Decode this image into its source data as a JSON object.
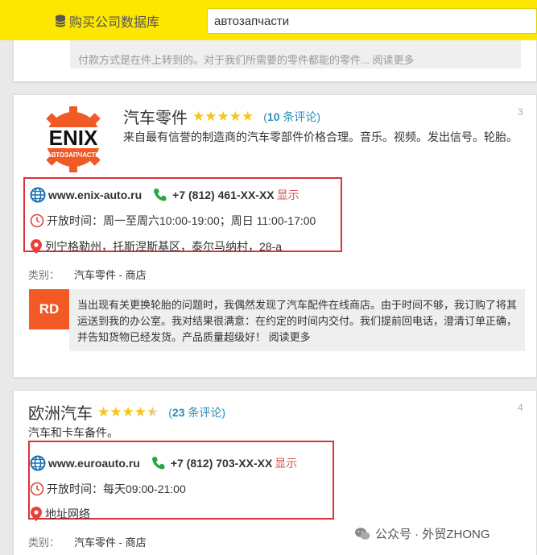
{
  "header": {
    "buy_button_label": "购买公司数据库",
    "search_value": "автозапчасти"
  },
  "colors": {
    "topbar": "#fde600",
    "star": "#f5c518",
    "star_empty": "#d8d8d8",
    "link": "#2a8db6",
    "highlight_box": "#e0303a",
    "show_link": "#d9534f",
    "avatar_bg": "#f15a24",
    "web_icon": "#1a6fb5",
    "phone_icon": "#2aa640",
    "clock_icon": "#d44",
    "pin_icon": "#e8403a"
  },
  "listings": [
    {
      "index": "3",
      "title": "汽车零件",
      "rating": 5,
      "reviews_count": "10",
      "reviews_suffix": "条评论",
      "logo_text": "ENIX",
      "logo_subtext": "АВТОЗАПЧАСТИ",
      "description": "来自最有信誉的制造商的汽车零部件价格合理。音乐。视频。发出信号。轮胎。",
      "website": "www.enix-auto.ru",
      "phone": "+7 (812) 461-XX-XX",
      "show_label": "显示",
      "hours": "开放时间：周一至周六10:00-19:00；周日 11:00-17:00",
      "address": "列宁格勒州，托斯涅斯基区，泰尔马纳村，28-a",
      "category_label": "类别：",
      "category": "汽车零件 - 商店",
      "review": {
        "avatar": "RD",
        "text": "当出现有关更换轮胎的问题时，我偶然发现了汽车配件在线商店。由于时间不够，我订购了将其运送到我的办公室。我对结果很满意：在约定的时间内交付。我们提前回电话，澄清订单正确，并告知货物已经发货。产品质量超级好！",
        "more": "阅读更多"
      }
    },
    {
      "index": "4",
      "title": "欧洲汽车",
      "rating": 4.5,
      "reviews_count": "23",
      "reviews_suffix": "条评论",
      "description": "汽车和卡车备件。",
      "website": "www.euroauto.ru",
      "phone": "+7 (812) 703-XX-XX",
      "show_label": "显示",
      "hours": "开放时间：每天09:00-21:00",
      "address": "地址网络",
      "category_label": "类别：",
      "category": "汽车零件 - 商店"
    }
  ],
  "previous_review_tail": "付款方式是在件上转到的。对于我们所需要的零件都能的零件... 阅读更多",
  "watermark": "公众号 · 外贸ZHONG"
}
